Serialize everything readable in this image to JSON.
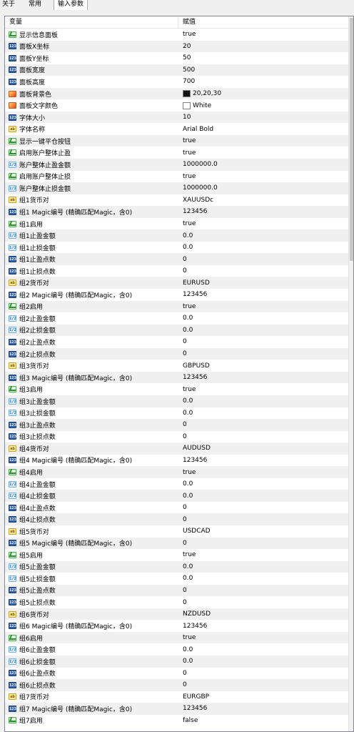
{
  "tabs": [
    {
      "label": "关于"
    },
    {
      "label": "常用"
    },
    {
      "label": "输入参数"
    }
  ],
  "header": {
    "col_variable": "变量",
    "col_value": "赋值"
  },
  "params": [
    {
      "icon": "bool",
      "name": "显示信息面板",
      "value": "true"
    },
    {
      "icon": "int",
      "name": "面板X坐标",
      "value": "20"
    },
    {
      "icon": "int",
      "name": "面板Y坐标",
      "value": "50"
    },
    {
      "icon": "int",
      "name": "面板宽度",
      "value": "500"
    },
    {
      "icon": "int",
      "name": "面板高度",
      "value": "700"
    },
    {
      "icon": "color",
      "name": "面板背景色",
      "value": "20,20,30",
      "swatch": "#141414"
    },
    {
      "icon": "color",
      "name": "面板文字颜色",
      "value": "White",
      "swatch": "#ffffff"
    },
    {
      "icon": "int",
      "name": "字体大小",
      "value": "10"
    },
    {
      "icon": "str",
      "name": "字体名称",
      "value": "Arial Bold"
    },
    {
      "icon": "bool",
      "name": "显示一键平仓按钮",
      "value": "true"
    },
    {
      "icon": "bool",
      "name": "启用账户整体止盈",
      "value": "true"
    },
    {
      "icon": "dbl",
      "name": "账户整体止盈金额",
      "value": "1000000.0"
    },
    {
      "icon": "bool",
      "name": "启用账户整体止损",
      "value": "true"
    },
    {
      "icon": "dbl",
      "name": "账户整体止损金额",
      "value": "1000000.0"
    },
    {
      "icon": "str",
      "name": "组1货币对",
      "value": "XAUUSDc"
    },
    {
      "icon": "int",
      "name": "组1 Magic编号 (精确匹配Magic，含0)",
      "value": "123456"
    },
    {
      "icon": "bool",
      "name": "组1启用",
      "value": "true"
    },
    {
      "icon": "dbl",
      "name": "组1止盈金额",
      "value": "0.0"
    },
    {
      "icon": "dbl",
      "name": "组1止损金额",
      "value": "0.0"
    },
    {
      "icon": "int",
      "name": "组1止盈点数",
      "value": "0"
    },
    {
      "icon": "int",
      "name": "组1止损点数",
      "value": "0"
    },
    {
      "icon": "str",
      "name": "组2货币对",
      "value": "EURUSD"
    },
    {
      "icon": "int",
      "name": "组2 Magic编号 (精确匹配Magic，含0)",
      "value": "123456"
    },
    {
      "icon": "bool",
      "name": "组2启用",
      "value": "true"
    },
    {
      "icon": "dbl",
      "name": "组2止盈金额",
      "value": "0.0"
    },
    {
      "icon": "dbl",
      "name": "组2止损金额",
      "value": "0.0"
    },
    {
      "icon": "int",
      "name": "组2止盈点数",
      "value": "0"
    },
    {
      "icon": "int",
      "name": "组2止损点数",
      "value": "0"
    },
    {
      "icon": "str",
      "name": "组3货币对",
      "value": "GBPUSD"
    },
    {
      "icon": "int",
      "name": "组3 Magic编号 (精确匹配Magic，含0)",
      "value": "123456"
    },
    {
      "icon": "bool",
      "name": "组3启用",
      "value": "true"
    },
    {
      "icon": "dbl",
      "name": "组3止盈金额",
      "value": "0.0"
    },
    {
      "icon": "dbl",
      "name": "组3止损金额",
      "value": "0.0"
    },
    {
      "icon": "int",
      "name": "组3止盈点数",
      "value": "0"
    },
    {
      "icon": "int",
      "name": "组3止损点数",
      "value": "0"
    },
    {
      "icon": "str",
      "name": "组4货币对",
      "value": "AUDUSD"
    },
    {
      "icon": "int",
      "name": "组4 Magic编号 (精确匹配Magic，含0)",
      "value": "123456"
    },
    {
      "icon": "bool",
      "name": "组4启用",
      "value": "true"
    },
    {
      "icon": "dbl",
      "name": "组4止盈金额",
      "value": "0.0"
    },
    {
      "icon": "dbl",
      "name": "组4止损金额",
      "value": "0.0"
    },
    {
      "icon": "int",
      "name": "组4止盈点数",
      "value": "0"
    },
    {
      "icon": "int",
      "name": "组4止损点数",
      "value": "0"
    },
    {
      "icon": "str",
      "name": "组5货币对",
      "value": "USDCAD"
    },
    {
      "icon": "int",
      "name": "组5 Magic编号 (精确匹配Magic，含0)",
      "value": "0"
    },
    {
      "icon": "bool",
      "name": "组5启用",
      "value": "true"
    },
    {
      "icon": "dbl",
      "name": "组5止盈金额",
      "value": "0.0"
    },
    {
      "icon": "dbl",
      "name": "组5止损金额",
      "value": "0.0"
    },
    {
      "icon": "int",
      "name": "组5止盈点数",
      "value": "0"
    },
    {
      "icon": "int",
      "name": "组5止损点数",
      "value": "0"
    },
    {
      "icon": "str",
      "name": "组6货币对",
      "value": "NZDUSD"
    },
    {
      "icon": "int",
      "name": "组6 Magic编号 (精确匹配Magic，含0)",
      "value": "123456"
    },
    {
      "icon": "bool",
      "name": "组6启用",
      "value": "true"
    },
    {
      "icon": "dbl",
      "name": "组6止盈金额",
      "value": "0.0"
    },
    {
      "icon": "dbl",
      "name": "组6止损金额",
      "value": "0.0"
    },
    {
      "icon": "int",
      "name": "组6止盈点数",
      "value": "0"
    },
    {
      "icon": "int",
      "name": "组6止损点数",
      "value": "0"
    },
    {
      "icon": "str",
      "name": "组7货币对",
      "value": "EURGBP"
    },
    {
      "icon": "int",
      "name": "组7 Magic编号 (精确匹配Magic，含0)",
      "value": "123456"
    },
    {
      "icon": "bool",
      "name": "组7启用",
      "value": "false"
    }
  ]
}
